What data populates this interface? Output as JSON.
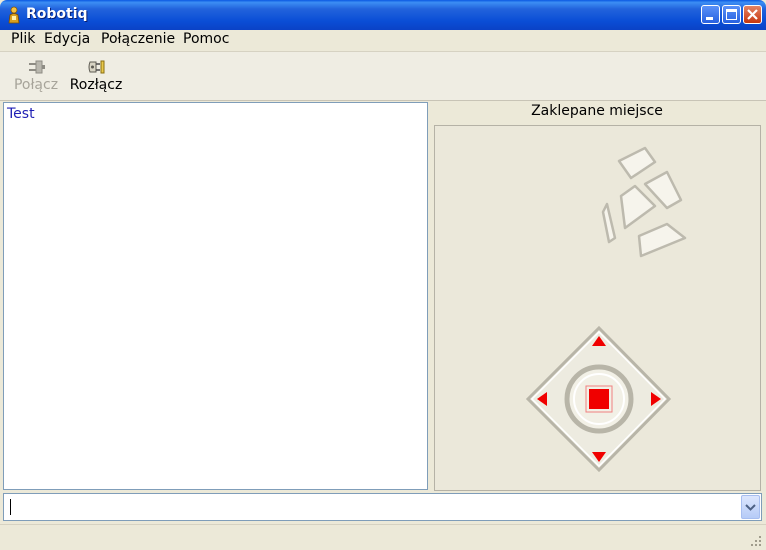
{
  "window": {
    "title": "Robotiq"
  },
  "menu": {
    "items": [
      "Plik",
      "Edycja",
      "Połączenie",
      "Pomoc"
    ]
  },
  "toolbar": {
    "connect": {
      "label": "Połącz",
      "enabled": false,
      "icon": "plug-connect-icon"
    },
    "disconnect": {
      "label": "Rozłącz",
      "enabled": true,
      "icon": "plug-disconnect-icon"
    }
  },
  "log": {
    "lines": [
      "Test"
    ]
  },
  "panel": {
    "title": "Zaklepane miejsce"
  },
  "command": {
    "value": ""
  },
  "colors": {
    "accent": "#FF0000",
    "log_text": "#1F1FB4",
    "titlebar": "#0A4ED6"
  }
}
